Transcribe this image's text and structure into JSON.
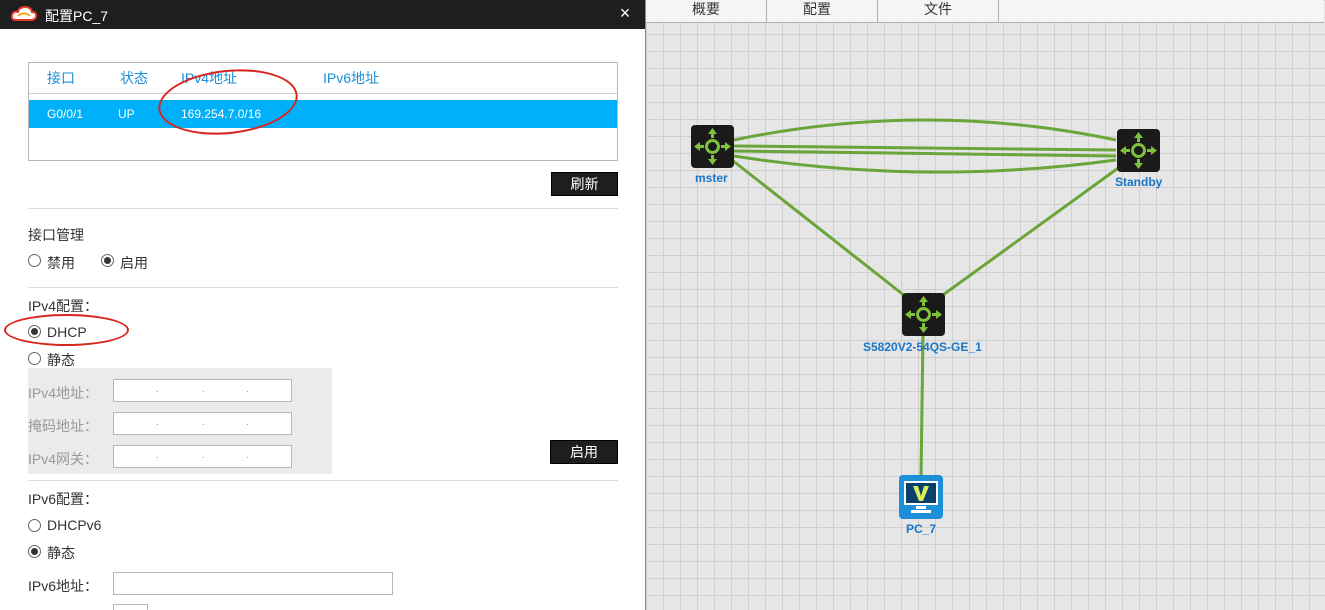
{
  "dialog": {
    "title": "配置PC_7",
    "close_label": "×",
    "table": {
      "headers": [
        "接口",
        "状态",
        "IPv4地址",
        "IPv6地址"
      ],
      "rows": [
        {
          "interface": "G0/0/1",
          "status": "UP",
          "ipv4": "169.254.7.0/16",
          "ipv6": ""
        }
      ]
    },
    "refresh_label": "刷新",
    "iface_mgmt": {
      "title": "接口管理",
      "disable_label": "禁用",
      "enable_label": "启用",
      "selected": "enable"
    },
    "ipv4": {
      "title": "IPv4配置：",
      "dhcp_label": "DHCP",
      "static_label": "静态",
      "selected": "dhcp",
      "addr_label": "IPv4地址：",
      "mask_label": "掩码地址：",
      "gateway_label": "IPv4网关：",
      "apply_label": "启用"
    },
    "ipv6": {
      "title": "IPv6配置：",
      "dhcpv6_label": "DHCPv6",
      "static_label": "静态",
      "selected": "static",
      "addr_label": "IPv6地址："
    }
  },
  "canvas": {
    "tabs": [
      "概要",
      "配置",
      "文件"
    ],
    "nodes": [
      {
        "id": "mster",
        "label": "mster",
        "type": "router-icon"
      },
      {
        "id": "standby",
        "label": "Standby",
        "type": "router-icon"
      },
      {
        "id": "switch",
        "label": "S5820V2-54QS-GE_1",
        "type": "switch-icon"
      },
      {
        "id": "pc7",
        "label": "PC_7",
        "type": "pc-icon"
      }
    ],
    "link_color": "#6aa53a",
    "label_color": "#1a76c8"
  }
}
